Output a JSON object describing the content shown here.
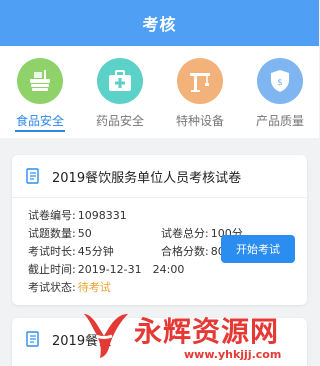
{
  "header": {
    "title": "考核"
  },
  "categories": [
    {
      "label": "食品安全",
      "active": true,
      "color": "#8fd26a"
    },
    {
      "label": "药品安全",
      "active": false,
      "color": "#5cd1c8"
    },
    {
      "label": "特种设备",
      "active": false,
      "color": "#f2b27a"
    },
    {
      "label": "产品质量",
      "active": false,
      "color": "#7fb6f2"
    }
  ],
  "exam": {
    "title": "2019餐饮服务单位人员考核试卷",
    "paper_no_label": "试卷编号:",
    "paper_no": "1098331",
    "question_count_label": "试题数量:",
    "question_count": "50",
    "total_score_label": "试卷总分:",
    "total_score": "100分",
    "duration_label": "考试时长:",
    "duration": "45分钟",
    "pass_score_label": "合格分数:",
    "pass_score": "80分",
    "deadline_label": "截止时间:",
    "deadline": "2019-12-31　24:00",
    "status_label": "考试状态:",
    "status": "待考试",
    "start_button": "开始考试"
  },
  "exam2": {
    "title_partial": "2019餐饮"
  },
  "watermark": {
    "text": "永辉资源网",
    "url": "www.yhkjjj.com"
  }
}
